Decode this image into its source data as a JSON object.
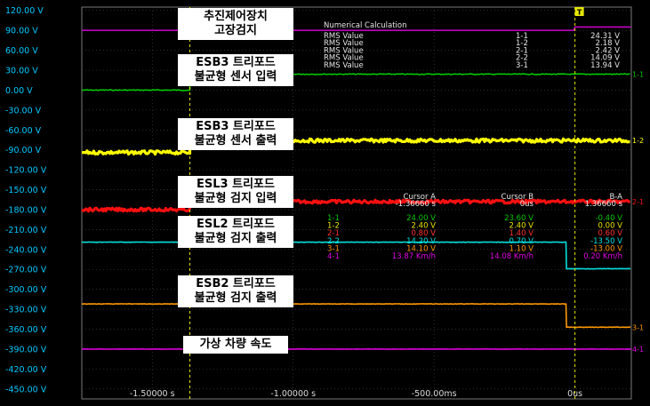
{
  "chart_data": {
    "type": "line",
    "xlabel": "",
    "ylabel": "",
    "xlim": [
      -1.75,
      0.2
    ],
    "ylim": [
      -465,
      125
    ],
    "y_ticks": [
      120,
      90,
      60,
      30,
      0,
      -30,
      -60,
      -90,
      -120,
      -150,
      -180,
      -210,
      -240,
      -270,
      -300,
      -330,
      -360,
      -390,
      -420,
      -450
    ],
    "y_tick_labels": [
      "120.00 V",
      "90.00 V",
      "60.00 V",
      "30.00 V",
      "0.00 V",
      "-30.00 V",
      "-60.00 V",
      "-90.00 V",
      "-120.00 V",
      "-150.00 V",
      "-180.00 V",
      "-210.00 V",
      "-240.00 V",
      "-270.00 V",
      "-300.00 V",
      "-330.00 V",
      "-360.00 V",
      "-390.00 V",
      "-420.00 V",
      "-450.00 V"
    ],
    "x_ticks": [
      -1.5,
      -1.0,
      -0.5,
      0
    ],
    "x_tick_labels": [
      "-1.50000 s",
      "-1.00000 s",
      "-500.00ms",
      "0us"
    ],
    "cursor_a": -1.3666,
    "cursor_b": 0,
    "series": [
      {
        "channel_label": "1-1",
        "color": "#00c800",
        "noise": 0.6,
        "points": [
          [
            -1.75,
            0
          ],
          [
            -1.3666,
            0
          ],
          [
            -1.3666,
            24
          ],
          [
            0.2,
            24
          ]
        ]
      },
      {
        "channel_label": "1-2",
        "color": "#ffff00",
        "noise": 2.6,
        "points": [
          [
            -1.75,
            -94
          ],
          [
            -1.3666,
            -94
          ],
          [
            -1.3666,
            -76
          ],
          [
            0.2,
            -76
          ]
        ]
      },
      {
        "channel_label": "2-1",
        "color": "#ff1010",
        "noise": 2.4,
        "points": [
          [
            -1.75,
            -180
          ],
          [
            -1.3666,
            -180
          ],
          [
            -1.3666,
            -168
          ],
          [
            0.2,
            -168
          ]
        ]
      },
      {
        "color": "#00e0e0",
        "noise": 0.3,
        "points": [
          [
            -1.75,
            -229
          ],
          [
            -0.03,
            -229
          ],
          [
            -0.03,
            -269
          ],
          [
            0.2,
            -269
          ]
        ]
      },
      {
        "channel_label": "3-1",
        "color": "#ff9900",
        "noise": 0.3,
        "points": [
          [
            -1.75,
            -322
          ],
          [
            -0.03,
            -322
          ],
          [
            -0.03,
            -357
          ],
          [
            0.2,
            -357
          ]
        ]
      },
      {
        "channel_label": "4-1",
        "color": "#e000e0",
        "noise": 0.2,
        "points": [
          [
            -1.75,
            -390
          ],
          [
            0.2,
            -390
          ]
        ]
      },
      {
        "color": "#c000c0",
        "noise": 0,
        "points": [
          [
            -1.75,
            90
          ],
          [
            0.0,
            90
          ],
          [
            0.0,
            95
          ],
          [
            0.2,
            95
          ]
        ]
      }
    ]
  },
  "calc": {
    "title": "Numerical Calculation",
    "rows": [
      {
        "label": "RMS Value",
        "ch": "1-1",
        "value": "24.31 V"
      },
      {
        "label": "RMS Value",
        "ch": "1-2",
        "value": "2.18 V"
      },
      {
        "label": "RMS Value",
        "ch": "2-1",
        "value": "2.42 V"
      },
      {
        "label": "RMS Value",
        "ch": "2-2",
        "value": "14.09 V"
      },
      {
        "label": "RMS Value",
        "ch": "3-1",
        "value": "13.94 V"
      }
    ]
  },
  "cursors": {
    "headers": [
      "Cursor A",
      "Cursor B",
      "B-A"
    ],
    "times": [
      "-1.36660 s",
      "0us",
      "1.36660 s"
    ],
    "rows": [
      {
        "ch": "1-1",
        "a": "24.00 V",
        "b": "23.60 V",
        "d": "-0.40 V",
        "color": "#00c800"
      },
      {
        "ch": "1-2",
        "a": "2.40 V",
        "b": "2.40 V",
        "d": "0.00 V",
        "color": "#e6e600"
      },
      {
        "ch": "2-1",
        "a": "0.80 V",
        "b": "1.40 V",
        "d": "0.60 V",
        "color": "#ff3030"
      },
      {
        "ch": "2-2",
        "a": "14.20 V",
        "b": "0.70 V",
        "d": "-13.50 V",
        "color": "#00e0e0"
      },
      {
        "ch": "3-1",
        "a": "14.10 V",
        "b": "1.10 V",
        "d": "-13.00 V",
        "color": "#ff9900"
      },
      {
        "ch": "4-1",
        "a": "13.87 Km/h",
        "b": "14.08 Km/h",
        "d": "0.20 Km/h",
        "color": "#e000e0"
      }
    ]
  },
  "annotations": [
    {
      "lines": [
        "추진제어장치",
        "고장검지"
      ]
    },
    {
      "lines": [
        "ESB3 트리포드",
        "불균형 센서 입력"
      ]
    },
    {
      "lines": [
        "ESB3 트리포드",
        "불균형 센서 출력"
      ]
    },
    {
      "lines": [
        "ESL3 트리포드",
        "불균형 검지 입력"
      ]
    },
    {
      "lines": [
        "ESL2 트리포드",
        "불균형 검지 출력"
      ]
    },
    {
      "lines": [
        "ESB2 트리포드",
        "불균형 검지 출력"
      ]
    },
    {
      "lines": [
        "가상 차량 속도"
      ]
    }
  ],
  "trigger_marker": "T"
}
